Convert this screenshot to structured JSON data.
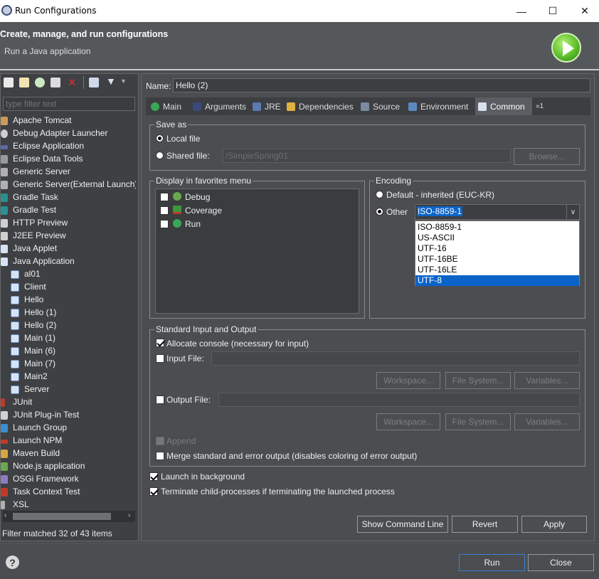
{
  "window": {
    "title": "Run Configurations",
    "minimize": "—",
    "maximize": "☐",
    "close": "✕"
  },
  "header": {
    "title": "Create, manage, and run configurations",
    "subtitle": "Run a Java application"
  },
  "left": {
    "filter_placeholder": "type filter text",
    "tree": [
      {
        "label": "Apache Tomcat",
        "level": 0
      },
      {
        "label": "Debug Adapter Launcher",
        "level": 0
      },
      {
        "label": "Eclipse Application",
        "level": 0
      },
      {
        "label": "Eclipse Data Tools",
        "level": 0
      },
      {
        "label": "Generic Server",
        "level": 0
      },
      {
        "label": "Generic Server(External Launch)",
        "level": 0
      },
      {
        "label": "Gradle Task",
        "level": 0
      },
      {
        "label": "Gradle Test",
        "level": 0
      },
      {
        "label": "HTTP Preview",
        "level": 0
      },
      {
        "label": "J2EE Preview",
        "level": 0
      },
      {
        "label": "Java Applet",
        "level": 0
      },
      {
        "label": "Java Application",
        "level": 0
      },
      {
        "label": "al01",
        "level": 1
      },
      {
        "label": "Client",
        "level": 1
      },
      {
        "label": "Hello",
        "level": 1
      },
      {
        "label": "Hello (1)",
        "level": 1
      },
      {
        "label": "Hello (2)",
        "level": 1
      },
      {
        "label": "Main (1)",
        "level": 1
      },
      {
        "label": "Main (6)",
        "level": 1
      },
      {
        "label": "Main (7)",
        "level": 1
      },
      {
        "label": "Main2",
        "level": 1
      },
      {
        "label": "Server",
        "level": 1
      },
      {
        "label": "JUnit",
        "level": 0
      },
      {
        "label": "JUnit Plug-in Test",
        "level": 0
      },
      {
        "label": "Launch Group",
        "level": 0
      },
      {
        "label": "Launch NPM",
        "level": 0
      },
      {
        "label": "Maven Build",
        "level": 0
      },
      {
        "label": "Node.js application",
        "level": 0
      },
      {
        "label": "OSGi Framework",
        "level": 0
      },
      {
        "label": "Task Context Test",
        "level": 0
      },
      {
        "label": "XSL",
        "level": 0
      }
    ],
    "status": "Filter matched 32 of 43 items"
  },
  "config": {
    "name_label": "Name:",
    "name_value": "Hello (2)",
    "tabs": [
      "Main",
      "Arguments",
      "JRE",
      "Dependencies",
      "Source",
      "Environment",
      "Common",
      "»1"
    ],
    "active_tab": "Common",
    "save_as": {
      "title": "Save as",
      "local": "Local file",
      "shared": "Shared file:",
      "shared_value": "/SimpleSpring01",
      "browse": "Browse..."
    },
    "favorites": {
      "title": "Display in favorites menu",
      "items": [
        "Debug",
        "Coverage",
        "Run"
      ]
    },
    "encoding": {
      "title": "Encoding",
      "default": "Default - inherited (EUC-KR)",
      "other": "Other",
      "value": "ISO-8859-1",
      "options": [
        "ISO-8859-1",
        "US-ASCII",
        "UTF-16",
        "UTF-16BE",
        "UTF-16LE",
        "UTF-8"
      ],
      "highlighted": "UTF-8"
    },
    "stdio": {
      "title": "Standard Input and Output",
      "allocate": "Allocate console (necessary for input)",
      "input_file": "Input File:",
      "output_file": "Output File:",
      "workspace": "Workspace...",
      "file_system": "File System...",
      "variables": "Variables...",
      "append": "Append",
      "merge": "Merge standard and error output (disables coloring of error output)"
    },
    "background": "Launch in background",
    "terminate": "Terminate child-processes if terminating the launched process",
    "show_cmd": "Show Command Line",
    "revert": "Revert",
    "apply": "Apply"
  },
  "footer": {
    "run": "Run",
    "close": "Close",
    "help": "?"
  },
  "colors": {
    "accent": "#0a64c8",
    "panel": "#4b4d50",
    "run_green": "#5cbf2a"
  }
}
